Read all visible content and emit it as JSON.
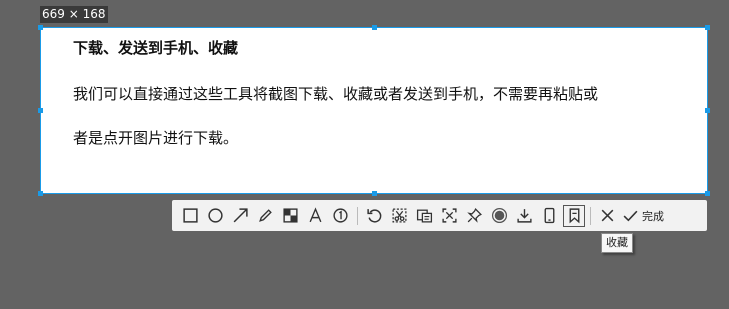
{
  "selection": {
    "size_label": "669 × 168"
  },
  "document": {
    "title": "下载、发送到手机、收藏",
    "line1": "我们可以直接通过这些工具将截图下载、收藏或者发送到手机，不需要再粘贴或",
    "line2": "者是点开图片进行下载。"
  },
  "toolbar": {
    "tools": [
      {
        "name": "rectangle-icon"
      },
      {
        "name": "ellipse-icon"
      },
      {
        "name": "arrow-icon"
      },
      {
        "name": "pen-icon"
      },
      {
        "name": "mosaic-icon"
      },
      {
        "name": "text-icon"
      },
      {
        "name": "number-marker-icon"
      },
      {
        "name": "undo-icon"
      },
      {
        "name": "screenshot-scissors-icon"
      },
      {
        "name": "ocr-icon"
      },
      {
        "name": "scan-code-icon"
      },
      {
        "name": "pin-icon"
      },
      {
        "name": "record-icon"
      },
      {
        "name": "download-icon"
      },
      {
        "name": "send-to-phone-icon"
      },
      {
        "name": "bookmark-icon"
      }
    ],
    "done_label": "完成"
  },
  "tooltip": {
    "text": "收藏"
  },
  "colors": {
    "background": "#636363",
    "selection_border": "#1a9be8",
    "toolbar_bg": "#f2f2f2"
  }
}
